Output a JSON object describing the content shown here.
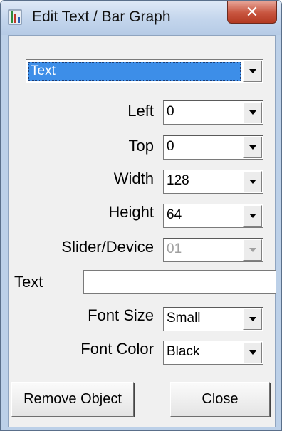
{
  "window": {
    "title": "Edit Text / Bar Graph",
    "close_symbol": "✕"
  },
  "object_type": {
    "value": "Text"
  },
  "fields": {
    "left": {
      "label": "Left",
      "value": "0"
    },
    "top": {
      "label": "Top",
      "value": "0"
    },
    "width": {
      "label": "Width",
      "value": "128"
    },
    "height": {
      "label": "Height",
      "value": "64"
    },
    "slider_device": {
      "label": "Slider/Device",
      "value": "01",
      "disabled": true
    },
    "text": {
      "label": "Text",
      "value": ""
    },
    "font_size": {
      "label": "Font Size",
      "value": "Small"
    },
    "font_color": {
      "label": "Font Color",
      "value": "Black"
    }
  },
  "buttons": {
    "remove_object": "Remove Object",
    "close": "Close"
  },
  "colors": {
    "selection_highlight": "#3d8ee8",
    "titlebar": "#c3d5ec",
    "close_button": "#c8553f",
    "dialog_face": "#f0f0f0"
  },
  "icons": {
    "window": "app-icon",
    "dropdown": "chevron-down-icon",
    "close": "close-icon"
  }
}
